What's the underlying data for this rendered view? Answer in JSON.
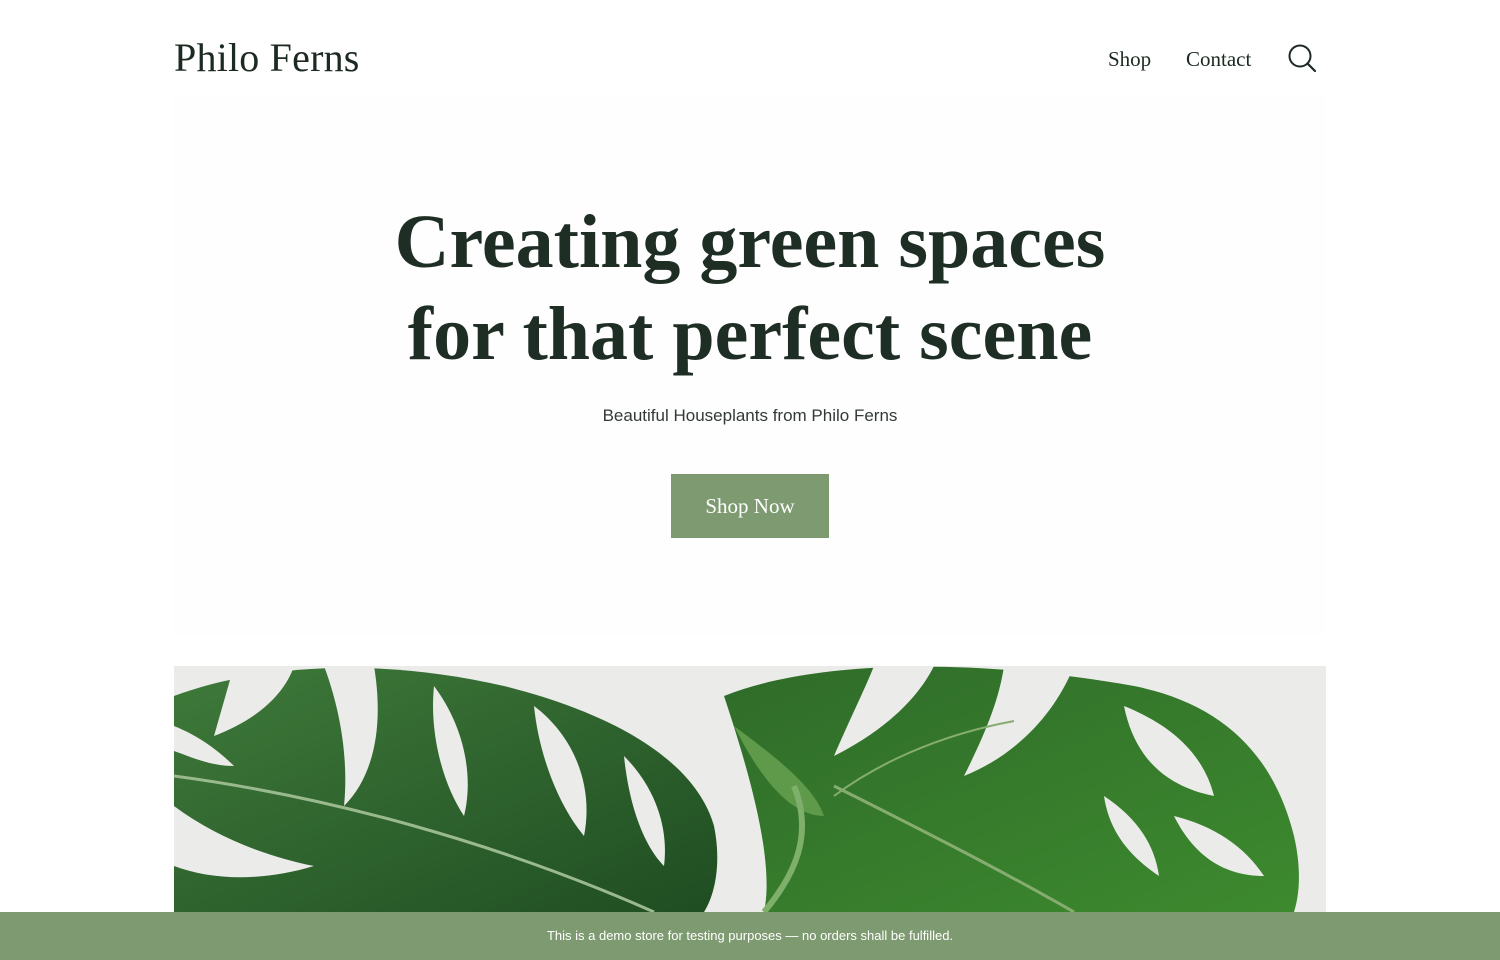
{
  "header": {
    "site_title": "Philo Ferns",
    "nav": [
      {
        "label": "Shop"
      },
      {
        "label": "Contact"
      }
    ],
    "search_icon": "search-icon"
  },
  "hero": {
    "title_line1": "Creating green spaces",
    "title_line2": "for that perfect scene",
    "subtitle": "Beautiful Houseplants from Philo Ferns",
    "cta_label": "Shop Now"
  },
  "hero_image": {
    "depicts": "monstera-leaves"
  },
  "demo_notice": {
    "text": "This is a demo store for testing purposes — no orders shall be fulfilled."
  },
  "colors": {
    "accent": "#7e9a70",
    "text_dark": "#1c2a22",
    "background": "#ffffff"
  }
}
